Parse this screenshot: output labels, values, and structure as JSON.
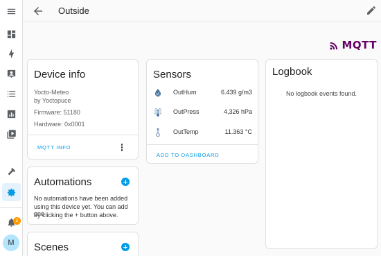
{
  "header": {
    "title": "Outside"
  },
  "logo": {
    "text": "MQTT",
    "color": "#660066"
  },
  "device_info": {
    "title": "Device info",
    "model": "Yocto-Meteo",
    "manufacturer": "by Yoctopuce",
    "firmware": "Firmware: 51180",
    "hardware": "Hardware: 0x0001",
    "action": "MQTT INFO"
  },
  "automations": {
    "title": "Automations",
    "text": [
      "No automations have been added",
      "using this device yet. You can add one",
      "by clicking the + button above."
    ]
  },
  "scenes": {
    "title": "Scenes"
  },
  "sensors": {
    "title": "Sensors",
    "rows": [
      {
        "icon": "water-percent-icon",
        "name": "OutHum",
        "value": "6.439 g/m3"
      },
      {
        "icon": "gauge-icon",
        "name": "OutPress",
        "value": "4,326 hPa"
      },
      {
        "icon": "thermometer-icon",
        "name": "OutTemp",
        "value": "11.363 °C"
      }
    ],
    "action": "ADD TO DASHBOARD"
  },
  "logbook": {
    "title": "Logbook",
    "empty_text": "No logbook events found."
  },
  "sidebar": {
    "notifications_count": "2",
    "avatar_initial": "M",
    "items": [
      "menu-icon",
      "overview-icon",
      "energy-icon",
      "map-icon",
      "logbook-icon",
      "history-icon",
      "media-icon",
      "developer-tools-icon",
      "settings-icon",
      "notifications-icon"
    ]
  },
  "colors": {
    "accent": "#039be5",
    "badge": "#ff9800"
  }
}
